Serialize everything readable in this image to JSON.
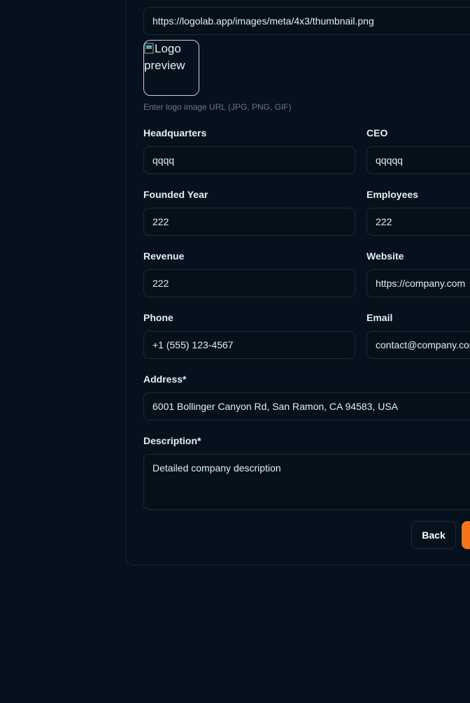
{
  "logo": {
    "url_value": "https://logolab.app/images/meta/4x3/thumbnail.png",
    "preview_alt": "Logo preview",
    "hint": "Enter logo image URL (JPG, PNG, GIF)"
  },
  "fields": {
    "headquarters": {
      "label": "Headquarters",
      "value": "qqqq"
    },
    "ceo": {
      "label": "CEO",
      "value": "qqqqq"
    },
    "founded_year": {
      "label": "Founded Year",
      "value": "222"
    },
    "employees": {
      "label": "Employees",
      "value": "222"
    },
    "revenue": {
      "label": "Revenue",
      "value": "222"
    },
    "website": {
      "label": "Website",
      "value": "https://company.com"
    },
    "phone": {
      "label": "Phone",
      "value": "+1 (555) 123-4567"
    },
    "email": {
      "label": "Email",
      "value": "contact@company.com"
    },
    "address": {
      "label": "Address*",
      "value": "6001 Bollinger Canyon Rd, San Ramon, CA 94583, USA"
    },
    "description": {
      "label": "Description*",
      "value": "Detailed company description"
    }
  },
  "actions": {
    "back_label": "Back"
  },
  "colors": {
    "background": "#05111c",
    "accent": "#f97316"
  }
}
